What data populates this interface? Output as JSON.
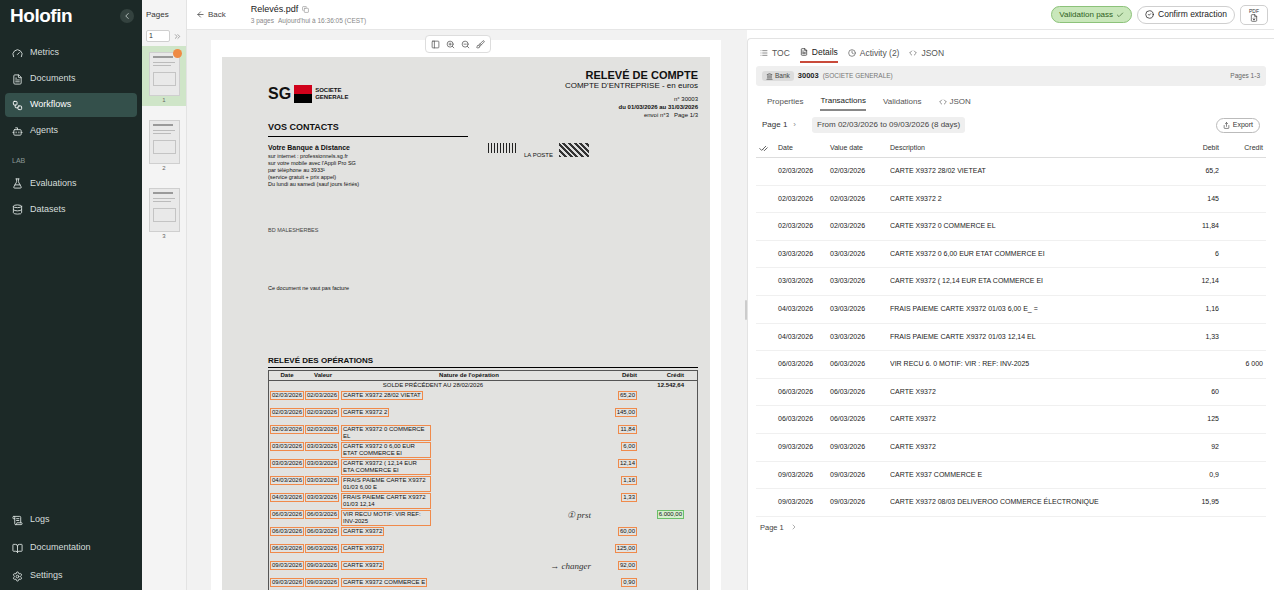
{
  "sidebar": {
    "logo": "Holofin",
    "items": [
      {
        "label": "Metrics",
        "selected": false
      },
      {
        "label": "Documents",
        "selected": false
      },
      {
        "label": "Workflows",
        "selected": true
      },
      {
        "label": "Agents",
        "selected": false
      }
    ],
    "section_label": "LAB",
    "lab_items": [
      {
        "label": "Evaluations",
        "selected": false
      },
      {
        "label": "Datasets",
        "selected": false
      }
    ],
    "bottom_items": [
      {
        "label": "Logs",
        "selected": false
      },
      {
        "label": "Documentation",
        "selected": false
      },
      {
        "label": "Settings",
        "selected": false
      }
    ]
  },
  "pages": {
    "title": "Pages",
    "page_input": "1",
    "thumbnails": [
      {
        "number": "1",
        "selected": true,
        "flagged": true
      },
      {
        "number": "2",
        "selected": false,
        "flagged": false
      },
      {
        "number": "3",
        "selected": false,
        "flagged": false
      }
    ]
  },
  "header": {
    "back": "Back",
    "file_name": "Relevés.pdf",
    "page_count": "3 pages",
    "timestamp": "Aujourd'hui à 16:36:05 (CEST)",
    "status": "Validation pass",
    "confirm": "Confirm extraction",
    "pdf": "PDF"
  },
  "document": {
    "logo": "SG",
    "bank_name": [
      "SOCIETE",
      "GENERALE"
    ],
    "title": "RELEVÉ DE COMPTE",
    "subtitle": "COMPTE D'ENTREPRISE - en euros",
    "account": "n° 30003",
    "period": "du 01/03/2026 au 31/03/2026",
    "sending": "envoi n°3   Page 1/3",
    "contacts_title": "VOS CONTACTS",
    "contacts_heading": "Votre Banque à Distance",
    "contact_lines": [
      "sur internet : professionnels.sg.fr",
      "sur votre mobile avec l'Appli Pro SG",
      "par téléphone au 3933¹",
      "(service gratuit + prix appel)",
      "Du lundi au samedi (sauf jours fériés)"
    ],
    "post": "LA POSTE",
    "address": "BD MALESHERBES",
    "notice": "Ce document ne vaut pas facture",
    "ops_title": "RELEVÉ DES OPÉRATIONS",
    "columns": [
      "Date",
      "Valeur",
      "Nature de l'opération",
      "Débit",
      "Crédit"
    ],
    "balance_label": "SOLDE PRÉCÉDENT AU 28/02/2026",
    "balance": "12.542,64",
    "rows": [
      {
        "date": "02/03/2026",
        "value_date": "02/03/2026",
        "nature": "CARTE X9372 28/02 VIETAT",
        "debit": "65,20",
        "credit": ""
      },
      {
        "date": "02/03/2026",
        "value_date": "02/03/2026",
        "nature": "CARTE X9372 2",
        "debit": "145,00",
        "credit": ""
      },
      {
        "date": "02/03/2026",
        "value_date": "02/03/2026",
        "nature": "CARTE X9372 0 COMMERCE EL",
        "debit": "11,84",
        "credit": ""
      },
      {
        "date": "03/03/2026",
        "value_date": "03/03/2026",
        "nature": "CARTE X9372 0 6,00 EUR ETAT COMMERCE EI",
        "debit": "6,00",
        "credit": ""
      },
      {
        "date": "03/03/2026",
        "value_date": "03/03/2026",
        "nature": "CARTE X9372 ( 12,14 EUR ETA COMMERCE EI",
        "debit": "12,14",
        "credit": ""
      },
      {
        "date": "04/03/2026",
        "value_date": "03/03/2026",
        "nature": "FRAIS PAIEME CARTE X9372 01/03 6,00 E",
        "debit": "1,16",
        "credit": ""
      },
      {
        "date": "04/03/2026",
        "value_date": "03/03/2026",
        "nature": "FRAIS PAIEME CARTE X9372 01/03 12,14",
        "debit": "1,33",
        "credit": ""
      },
      {
        "date": "06/03/2026",
        "value_date": "06/03/2026",
        "nature": "VIR RECU MOTIF: VIR REF: INV-2025",
        "debit": "",
        "credit": "6.000,00",
        "note": "① prst"
      },
      {
        "date": "06/03/2026",
        "value_date": "06/03/2026",
        "nature": "CARTE X9372",
        "debit": "60,00",
        "credit": ""
      },
      {
        "date": "06/03/2026",
        "value_date": "06/03/2026",
        "nature": "CARTE X9372",
        "debit": "125,00",
        "credit": ""
      },
      {
        "date": "09/03/2026",
        "value_date": "09/03/2026",
        "nature": "CARTE X9372",
        "debit": "92,00",
        "credit": "",
        "note": "→ changer"
      },
      {
        "date": "09/03/2026",
        "value_date": "09/03/2026",
        "nature": "CARTE X9372 COMMERCE E",
        "debit": "0,90",
        "credit": ""
      }
    ]
  },
  "panel": {
    "tabs": [
      {
        "label": "TOC",
        "selected": false
      },
      {
        "label": "Details",
        "selected": true
      },
      {
        "label": "Activity (2)",
        "selected": false
      },
      {
        "label": "JSON",
        "selected": false
      }
    ],
    "entity": {
      "tag": "Bank",
      "code": "30003",
      "name": "(SOCIETE GENERALE)",
      "pages": "Pages 1-3"
    },
    "subtabs": [
      {
        "label": "Properties",
        "selected": false
      },
      {
        "label": "Transactions",
        "selected": true
      },
      {
        "label": "Validations",
        "selected": false
      },
      {
        "label": "JSON",
        "selected": false
      }
    ],
    "pager": "Page 1",
    "range": "From 02/03/2026 to 09/03/2026 (8 days)",
    "export": "Export",
    "columns": [
      "Date",
      "Value date",
      "Description",
      "Debit",
      "Credit"
    ],
    "rows": [
      {
        "date": "02/03/2026",
        "value_date": "02/03/2026",
        "description": "CARTE X9372 28/02 VIETEAT",
        "debit": "65,2",
        "credit": ""
      },
      {
        "date": "02/03/2026",
        "value_date": "02/03/2026",
        "description": "CARTE X9372 2",
        "debit": "145",
        "credit": ""
      },
      {
        "date": "02/03/2026",
        "value_date": "02/03/2026",
        "description": "CARTE X9372 0 COMMERCE EL",
        "debit": "11,84",
        "credit": ""
      },
      {
        "date": "03/03/2026",
        "value_date": "03/03/2026",
        "description": "CARTE X9372 0 6,00 EUR ETAT COMMERCE EI",
        "debit": "6",
        "credit": ""
      },
      {
        "date": "03/03/2026",
        "value_date": "03/03/2026",
        "description": "CARTE X9372 ( 12,14 EUR ETA COMMERCE EI",
        "debit": "12,14",
        "credit": ""
      },
      {
        "date": "04/03/2026",
        "value_date": "03/03/2026",
        "description": "FRAIS PAIEME CARTE X9372 01/03 6,00 E_ =",
        "debit": "1,16",
        "credit": ""
      },
      {
        "date": "04/03/2026",
        "value_date": "03/03/2026",
        "description": "FRAIS PAIEME CARTE X9372 01/03 12,14 EL",
        "debit": "1,33",
        "credit": ""
      },
      {
        "date": "06/03/2026",
        "value_date": "06/03/2026",
        "description": "VIR RECU 6. 0 MOTIF: VIR : REF: INV-2025",
        "debit": "",
        "credit": "6 000"
      },
      {
        "date": "06/03/2026",
        "value_date": "06/03/2026",
        "description": "CARTE X9372",
        "debit": "60",
        "credit": ""
      },
      {
        "date": "06/03/2026",
        "value_date": "06/03/2026",
        "description": "CARTE X9372",
        "debit": "125",
        "credit": ""
      },
      {
        "date": "09/03/2026",
        "value_date": "09/03/2026",
        "description": "CARTE X9372",
        "debit": "92",
        "credit": ""
      },
      {
        "date": "09/03/2026",
        "value_date": "09/03/2026",
        "description": "CARTE X937 COMMERCE E",
        "debit": "0,9",
        "credit": ""
      },
      {
        "date": "09/03/2026",
        "value_date": "09/03/2026",
        "description": "CARTE X9372 08/03 DELIVEROO COMMERCE ÉLECTRONIQUE",
        "debit": "15,95",
        "credit": ""
      }
    ],
    "next": "›",
    "footer": "Page 1"
  }
}
